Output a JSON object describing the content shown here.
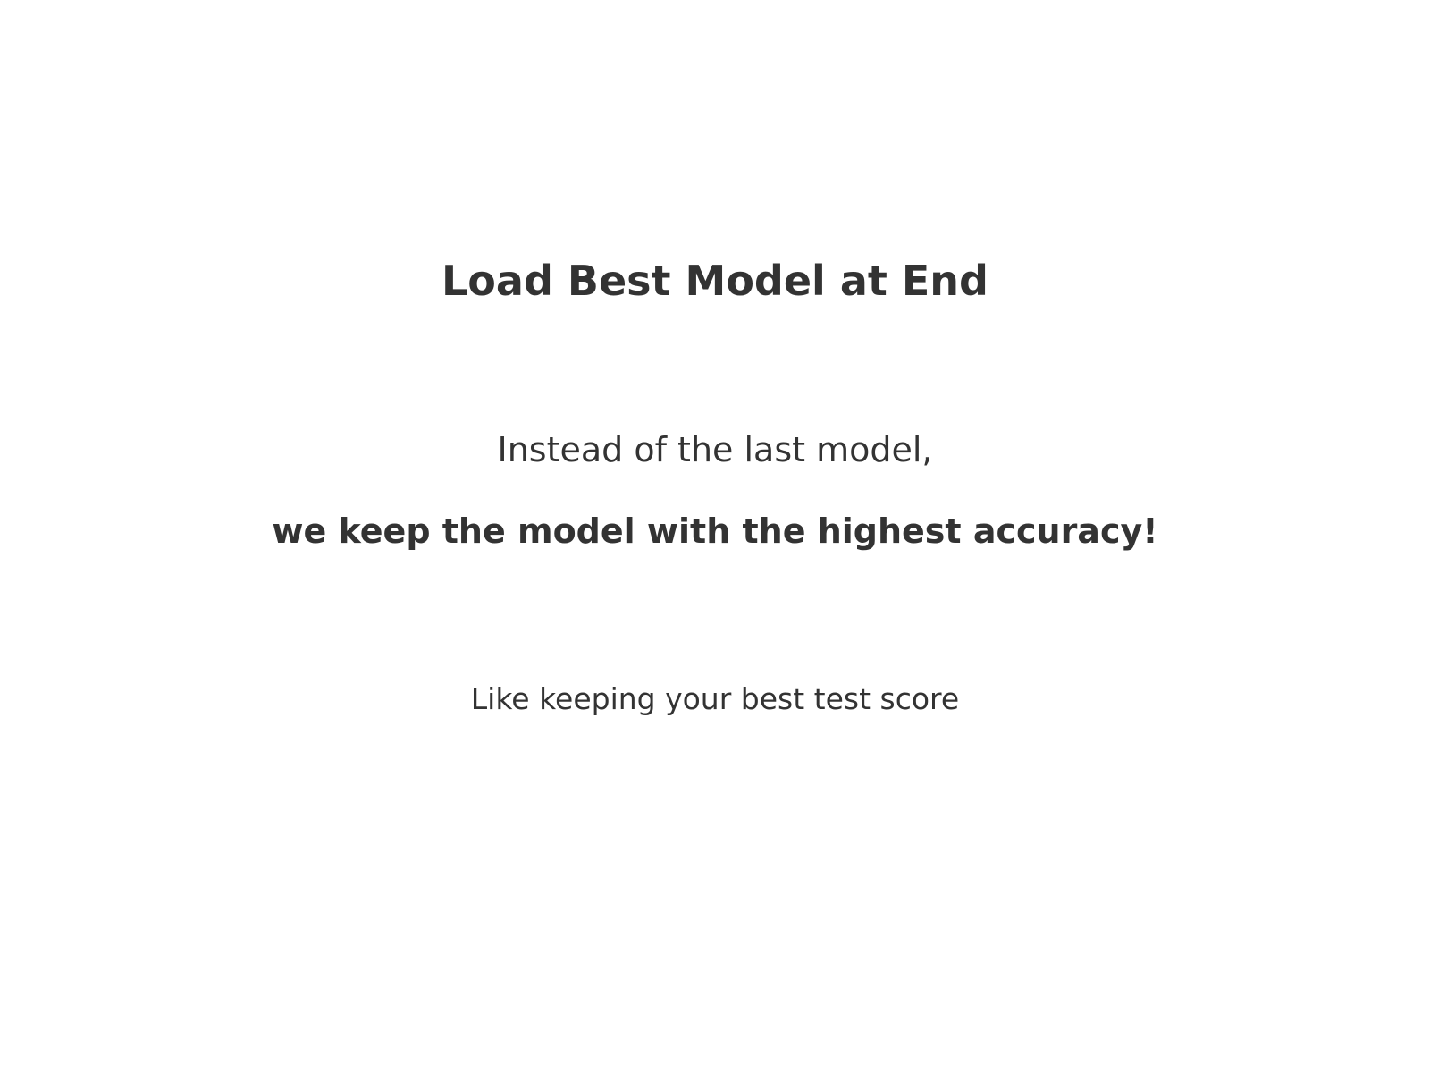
{
  "slide": {
    "title": "Load Best Model at End",
    "lead": "Instead of the last model,",
    "emphasis": "we keep the model with the highest accuracy!",
    "analogy": "Like keeping your best test score"
  },
  "colors": {
    "background": "#ffffff",
    "text": "#333333"
  }
}
